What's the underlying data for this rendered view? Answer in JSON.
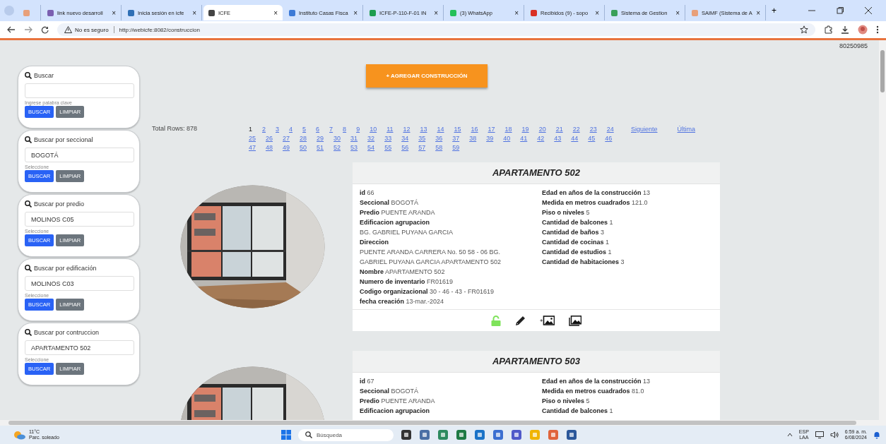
{
  "browser": {
    "tabs": [
      {
        "selected": false,
        "color": "#e8a07a"
      },
      {
        "title": "link nuevo desarroll",
        "close": "×",
        "selected": false,
        "color": "#7b5fb0"
      },
      {
        "title": "Inicia sesión en icfe",
        "close": "×",
        "selected": false,
        "color": "#2f6fb5"
      },
      {
        "title": "ICFE",
        "close": "×",
        "selected": true,
        "color": "#444444"
      },
      {
        "title": "Instituto Casas Fisca",
        "close": "×",
        "selected": false,
        "color": "#3d7ad6"
      },
      {
        "title": "ICFE-P-110-F-01 IN",
        "close": "×",
        "selected": false,
        "color": "#1e9e50"
      },
      {
        "title": "(3) WhatsApp",
        "close": "×",
        "selected": false,
        "color": "#25c05a"
      },
      {
        "title": "Recibidos (9) - sopo",
        "close": "×",
        "selected": false,
        "color": "#d93025"
      },
      {
        "title": "Sistema de Gestion",
        "close": "×",
        "selected": false,
        "color": "#3aa05a"
      },
      {
        "title": "SAIMF (Sistema de A",
        "close": "×",
        "selected": false,
        "color": "#e8a07a"
      }
    ],
    "new_tab": "+",
    "url_warning": "No es seguro",
    "url": "http://webicfe:8082/construccion"
  },
  "page": {
    "user_code": "80250985",
    "add_button": "+ AGREGAR CONSTRUCCIÓN",
    "filters": [
      {
        "title": "Buscar",
        "hint": "Ingrese palabra clave",
        "search_button": "BUSCAR",
        "clear_button": "LIMPIAR"
      },
      {
        "title": "Buscar por seccional",
        "value": "BOGOTÁ",
        "hint": "Seleccione",
        "search_button": "BUSCAR",
        "clear_button": "LIMPIAR"
      },
      {
        "title": "Buscar por predio",
        "value": "MOLINOS C05",
        "hint": "Seleccione",
        "search_button": "BUSCAR",
        "clear_button": "LIMPIAR"
      },
      {
        "title": "Buscar por edificación",
        "value": "MOLINOS C03",
        "hint": "Seleccione",
        "search_button": "BUSCAR",
        "clear_button": "LIMPIAR"
      },
      {
        "title": "Buscar por contruccion",
        "value": "APARTAMENTO 502",
        "hint": "Seleccione",
        "search_button": "BUSCAR",
        "clear_button": "LIMPIAR"
      }
    ],
    "total_rows": "Total Rows: 878",
    "pagination": {
      "pages": [
        {
          "label": "1",
          "selected": true
        },
        {
          "label": "2",
          "selected": false
        },
        {
          "label": "3",
          "selected": false
        },
        {
          "label": "4",
          "selected": false
        },
        {
          "label": "5",
          "selected": false
        },
        {
          "label": "6",
          "selected": false
        },
        {
          "label": "7",
          "selected": false
        },
        {
          "label": "8",
          "selected": false
        },
        {
          "label": "9",
          "selected": false
        },
        {
          "label": "10",
          "selected": false
        },
        {
          "label": "11",
          "selected": false
        },
        {
          "label": "12",
          "selected": false
        },
        {
          "label": "13",
          "selected": false
        },
        {
          "label": "14",
          "selected": false
        },
        {
          "label": "15",
          "selected": false
        },
        {
          "label": "16",
          "selected": false
        },
        {
          "label": "17",
          "selected": false
        },
        {
          "label": "18",
          "selected": false
        },
        {
          "label": "19",
          "selected": false
        },
        {
          "label": "20",
          "selected": false
        },
        {
          "label": "21",
          "selected": false
        },
        {
          "label": "22",
          "selected": false
        },
        {
          "label": "23",
          "selected": false
        },
        {
          "label": "24",
          "selected": false
        },
        {
          "label": "25",
          "selected": false
        },
        {
          "label": "26",
          "selected": false
        },
        {
          "label": "27",
          "selected": false
        },
        {
          "label": "28",
          "selected": false
        },
        {
          "label": "29",
          "selected": false
        },
        {
          "label": "30",
          "selected": false
        },
        {
          "label": "31",
          "selected": false
        },
        {
          "label": "32",
          "selected": false
        },
        {
          "label": "33",
          "selected": false
        },
        {
          "label": "34",
          "selected": false
        },
        {
          "label": "35",
          "selected": false
        },
        {
          "label": "36",
          "selected": false
        },
        {
          "label": "37",
          "selected": false
        },
        {
          "label": "38",
          "selected": false
        },
        {
          "label": "39",
          "selected": false
        },
        {
          "label": "40",
          "selected": false
        },
        {
          "label": "41",
          "selected": false
        },
        {
          "label": "42",
          "selected": false
        },
        {
          "label": "43",
          "selected": false
        },
        {
          "label": "44",
          "selected": false
        },
        {
          "label": "45",
          "selected": false
        },
        {
          "label": "46",
          "selected": false
        },
        {
          "label": "47",
          "selected": false
        },
        {
          "label": "48",
          "selected": false
        },
        {
          "label": "49",
          "selected": false
        },
        {
          "label": "50",
          "selected": false
        },
        {
          "label": "51",
          "selected": false
        },
        {
          "label": "52",
          "selected": false
        },
        {
          "label": "53",
          "selected": false
        },
        {
          "label": "54",
          "selected": false
        },
        {
          "label": "55",
          "selected": false
        },
        {
          "label": "56",
          "selected": false
        },
        {
          "label": "57",
          "selected": false
        },
        {
          "label": "58",
          "selected": false
        },
        {
          "label": "59",
          "selected": false
        }
      ],
      "next": "Siguiente",
      "last": "Última"
    },
    "constructions": [
      {
        "title": "APARTAMENTO 502",
        "picture": {
          "kind": "picture"
        },
        "actions": true,
        "left": [
          {
            "label": "id",
            "value": "66",
            "kind": "inline"
          },
          {
            "label": "Seccional",
            "value": "BOGOTÁ",
            "kind": "inline"
          },
          {
            "label": "Predio",
            "value": "PUENTE ARANDA",
            "kind": "inline"
          },
          {
            "label": "Edificacion agrupacion",
            "value": "BG. GABRIEL PUYANA GARCIA",
            "kind": "block"
          },
          {
            "label": "Direccion",
            "value": "PUENTE ARANDA CARRERA No. 50 58 - 06 BG. GABRIEL PUYANA GARCIA APARTAMENTO 502",
            "kind": "block"
          },
          {
            "label": "Nombre",
            "value": "APARTAMENTO 502",
            "kind": "inline"
          },
          {
            "label": "Numero de inventario",
            "value": "FR01619",
            "kind": "inline"
          },
          {
            "label": "Codigo organizacional",
            "value": "30 - 46 - 43 - FR01619",
            "kind": "inline"
          },
          {
            "label": "fecha creación",
            "value": "13-mar.-2024",
            "kind": "inline"
          }
        ],
        "right": [
          {
            "label": "Edad en años de la construcción",
            "value": "13",
            "kind": "inline"
          },
          {
            "label": "Medida en metros cuadrados",
            "value": "121.0",
            "kind": "inline"
          },
          {
            "label": "Piso o niveles",
            "value": "5",
            "kind": "inline"
          },
          {
            "label": "Cantidad de balcones",
            "value": "1",
            "kind": "inline"
          },
          {
            "label": "Cantidad de baños",
            "value": "3",
            "kind": "inline"
          },
          {
            "label": "Cantidad de cocinas",
            "value": "1",
            "kind": "inline"
          },
          {
            "label": "Cantidad de estudios",
            "value": "1",
            "kind": "inline"
          },
          {
            "label": "Cantidad de habitaciones",
            "value": "3",
            "kind": "inline"
          }
        ]
      },
      {
        "title": "APARTAMENTO 503",
        "picture": {
          "kind": "picture"
        },
        "actions": false,
        "left": [
          {
            "label": "id",
            "value": "67",
            "kind": "inline"
          },
          {
            "label": "Seccional",
            "value": "BOGOTÁ",
            "kind": "inline"
          },
          {
            "label": "Predio",
            "value": "PUENTE ARANDA",
            "kind": "inline"
          },
          {
            "label": "Edificacion agrupacion",
            "kind": "block"
          }
        ],
        "right": [
          {
            "label": "Edad en años de la construcción",
            "value": "13",
            "kind": "inline"
          },
          {
            "label": "Medida en metros cuadrados",
            "value": "81.0",
            "kind": "inline"
          },
          {
            "label": "Piso o niveles",
            "value": "5",
            "kind": "inline"
          },
          {
            "label": "Cantidad de balcones",
            "value": "1",
            "kind": "inline"
          }
        ]
      }
    ]
  },
  "taskbar": {
    "temperature": "11°C",
    "weather": "Parc. soleado",
    "search_placeholder": "Búsqueda",
    "language": "ESP",
    "layout": "LAA",
    "time": "6:59 a. m.",
    "date": "6/08/2024"
  }
}
